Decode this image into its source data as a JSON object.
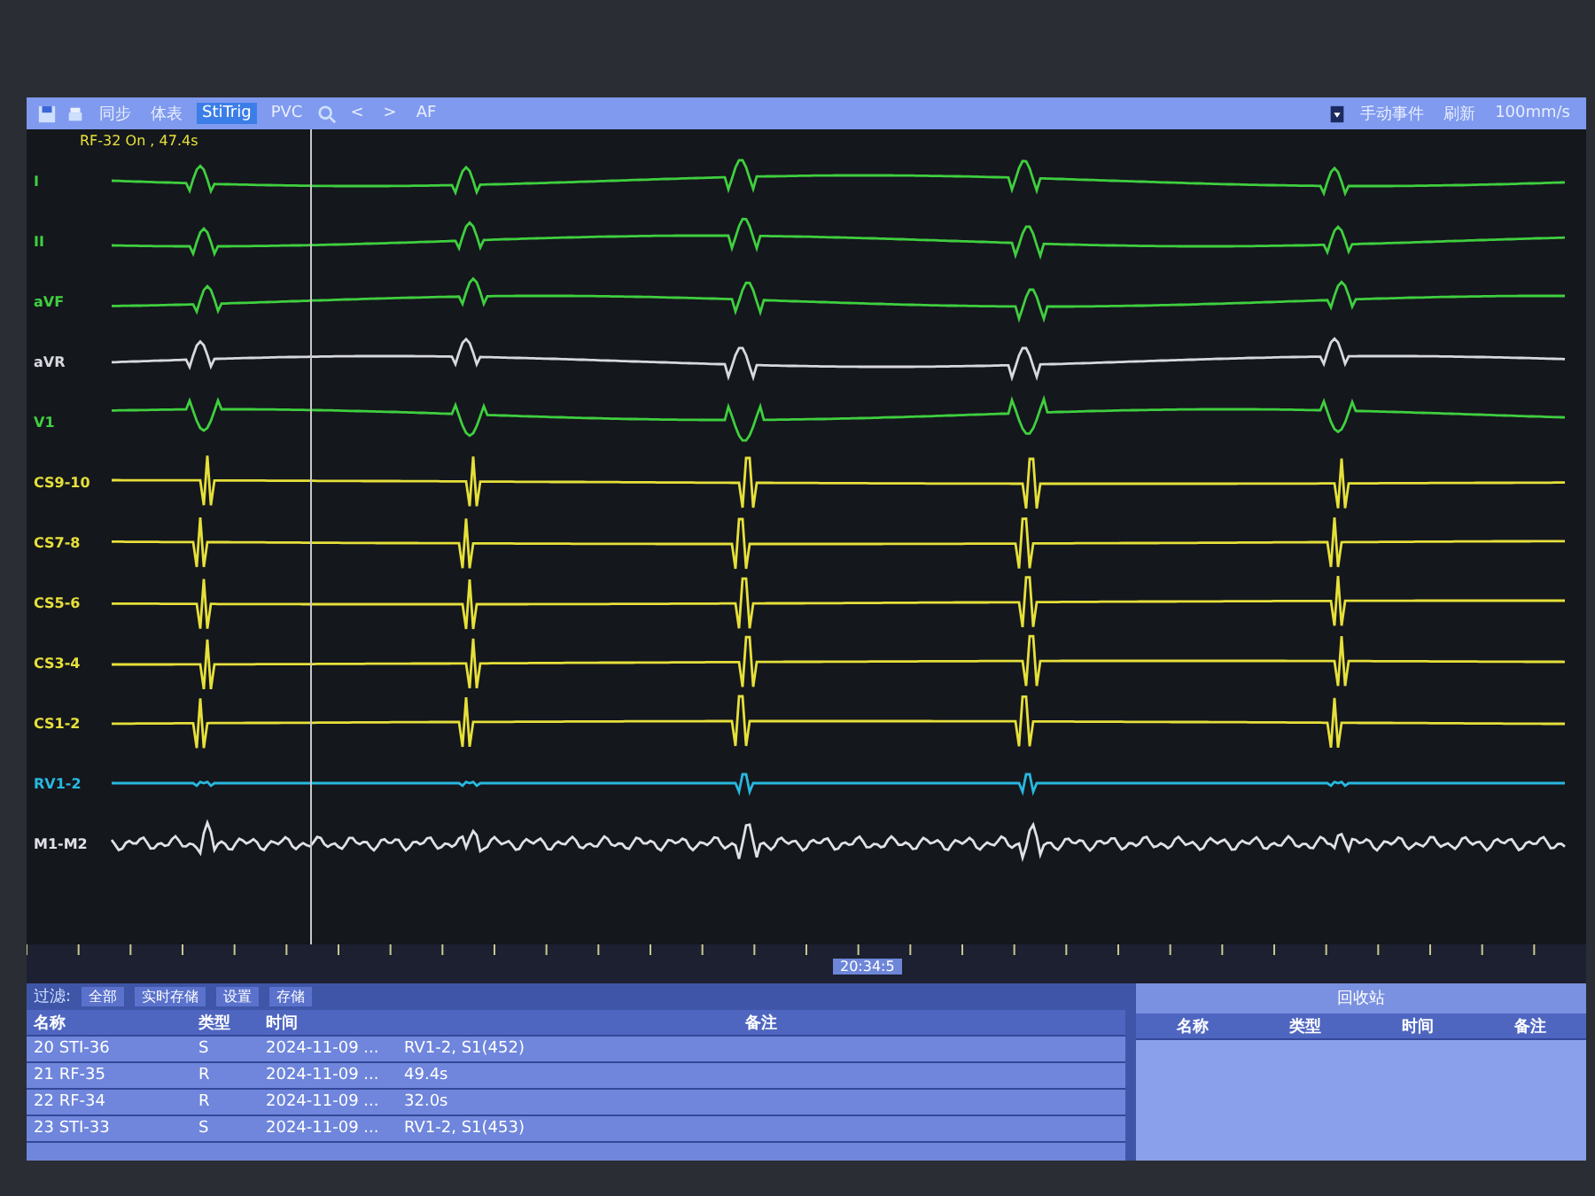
{
  "toolbar": {
    "items": [
      {
        "label": "同步",
        "selected": false
      },
      {
        "label": "体表",
        "selected": false
      },
      {
        "label": "StiTrig",
        "selected": true
      },
      {
        "label": "PVC",
        "selected": false
      }
    ],
    "nav": [
      "<",
      ">",
      "AF"
    ],
    "right": [
      "手动事件",
      "刷新",
      "100mm/s"
    ]
  },
  "marker_note": "RF-32 On , 47.4s",
  "channels": [
    {
      "label": "I",
      "color": "#3fcf3f",
      "kind": "surface"
    },
    {
      "label": "II",
      "color": "#3fcf3f",
      "kind": "surface"
    },
    {
      "label": "aVF",
      "color": "#3fcf3f",
      "kind": "surface"
    },
    {
      "label": "aVR",
      "color": "#d8d8e0",
      "kind": "surface"
    },
    {
      "label": "V1",
      "color": "#3fcf3f",
      "kind": "deep"
    },
    {
      "label": "CS9-10",
      "color": "#e6e03a",
      "kind": "intra"
    },
    {
      "label": "CS7-8",
      "color": "#e6e03a",
      "kind": "intra"
    },
    {
      "label": "CS5-6",
      "color": "#e6e03a",
      "kind": "intra"
    },
    {
      "label": "CS3-4",
      "color": "#e6e03a",
      "kind": "intra"
    },
    {
      "label": "CS1-2",
      "color": "#e6e03a",
      "kind": "intra"
    },
    {
      "label": "RV1-2",
      "color": "#28b8e0",
      "kind": "small"
    },
    {
      "label": "M1-M2",
      "color": "#e0e0e8",
      "kind": "noise"
    }
  ],
  "ruler_time": "20:34:5",
  "events": {
    "filter_label": "过滤:",
    "filter_value": "全部",
    "actions": [
      "实时存储",
      "设置",
      "存储"
    ],
    "columns": [
      "名称",
      "类型",
      "时间",
      "备注"
    ],
    "rows": [
      {
        "index": "20",
        "name": "STI-36",
        "type": "S",
        "time": "2024-11-09 ...",
        "note": "RV1-2, S1(452)"
      },
      {
        "index": "21",
        "name": "RF-35",
        "type": "R",
        "time": "2024-11-09 ...",
        "note": "49.4s"
      },
      {
        "index": "22",
        "name": "RF-34",
        "type": "R",
        "time": "2024-11-09 ...",
        "note": "32.0s"
      },
      {
        "index": "23",
        "name": "STI-33",
        "type": "S",
        "time": "2024-11-09 ...",
        "note": "RV1-2, S1(453)"
      }
    ]
  },
  "recycle": {
    "title": "回收站",
    "columns": [
      "名称",
      "类型",
      "时间",
      "备注"
    ]
  }
}
